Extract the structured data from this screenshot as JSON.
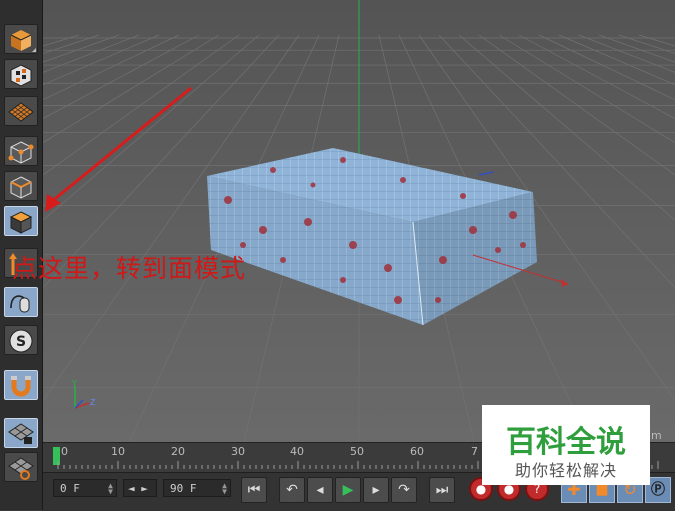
{
  "annotation": {
    "text": "点这里，转到面模式"
  },
  "watermark": {
    "title": "百科全说",
    "subtitle": "助你轻松解决"
  },
  "timeline": {
    "ticks": [
      "0",
      "10",
      "20",
      "30",
      "40",
      "50",
      "60",
      "7"
    ],
    "fragment": "m"
  },
  "transport": {
    "start_frame": "0 F",
    "end_frame": "90 F",
    "step_arrows": "◄ ►"
  },
  "axis_gizmo": {
    "y": "Y",
    "z": "Z"
  },
  "icons": {
    "toolbar": [
      "cube-icon",
      "checker-cube-icon",
      "grid-plane-icon",
      "points-mode-icon",
      "edges-mode-icon",
      "polygons-mode-icon",
      "axis-mode-icon",
      "mouse-tweak-icon",
      "snap-s-icon",
      "magnet-icon",
      "lock-grid-icon",
      "workplane-icon"
    ],
    "transport": [
      "go-start-icon",
      "prev-key-icon",
      "step-back-icon",
      "play-icon",
      "step-forward-icon",
      "next-key-icon",
      "go-end-icon",
      "record-icon",
      "autokey-icon",
      "keyframe-icon",
      "move-key-icon",
      "scale-key-icon",
      "rotate-key-icon",
      "param-key-icon"
    ]
  },
  "colors": {
    "annotation": "#d01818",
    "watermark_green": "#2f9e3c",
    "active_tool": "#8aa6c8",
    "play": "#35c05a",
    "record": "#c22b2b"
  }
}
